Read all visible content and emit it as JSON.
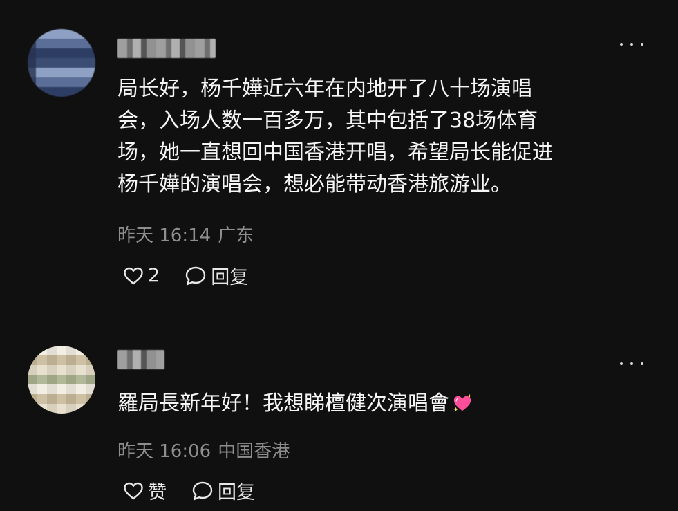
{
  "comments": [
    {
      "text": "局长好，杨千嬅近六年在内地开了八十场演唱\n会，入场人数一百多万，其中包括了38场体育\n场，她一直想回中国香港开唱，希望局长能促进\n杨千嬅的演唱会，想必能带动香港旅游业。",
      "time": "昨天 16:14",
      "location": "广东",
      "like_label": "2",
      "reply_label": "回复",
      "more_icon": "more-dots-icon"
    },
    {
      "text": "羅局長新年好！我想睇檀健次演唱會",
      "emoji": "sparkling-heart-emoji",
      "time": "昨天 16:06",
      "location": "中国香港",
      "like_label": "赞",
      "reply_label": "回复",
      "more_icon": "more-dots-icon"
    }
  ],
  "colors": {
    "background": "#101010",
    "text": "#f5f5f5",
    "meta": "#8e8e8e",
    "heart_emoji": "#ff4f9a"
  }
}
